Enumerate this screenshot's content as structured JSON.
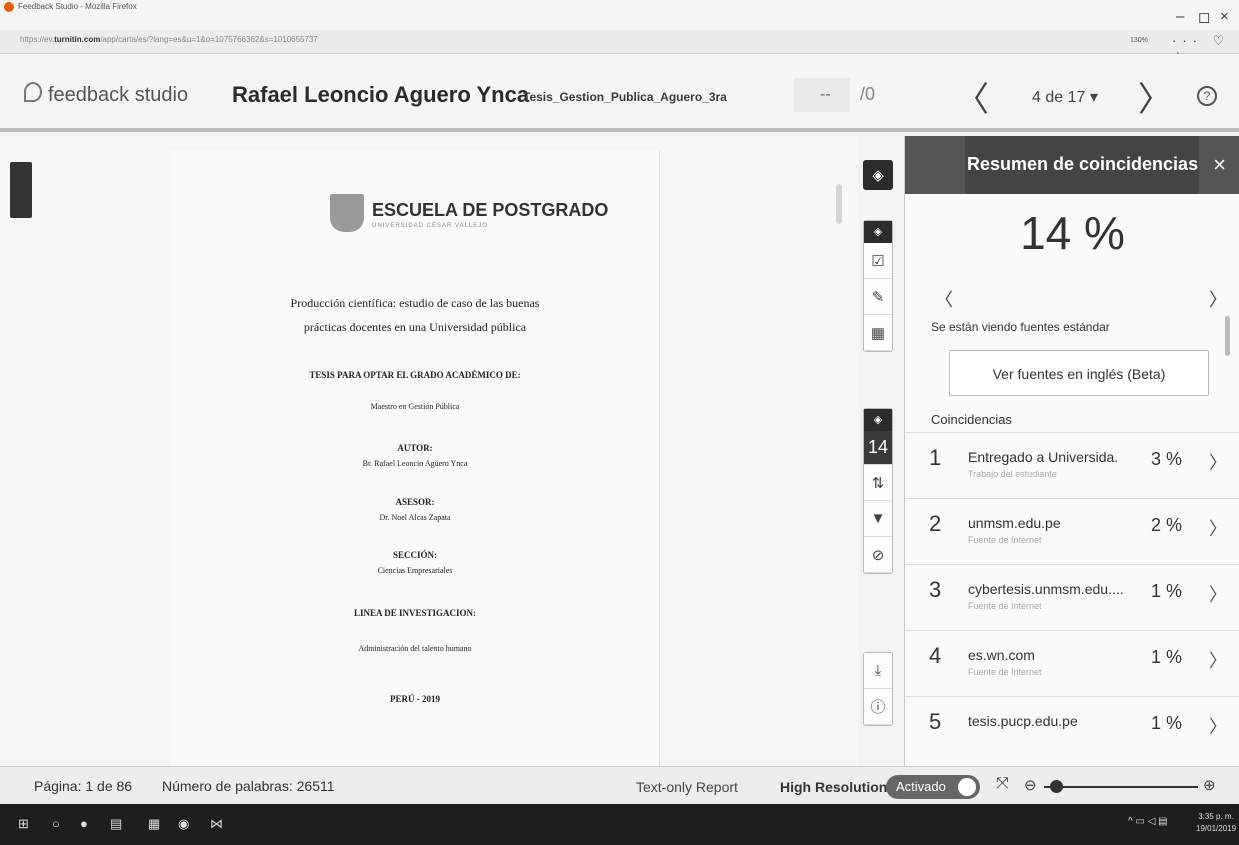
{
  "browser": {
    "window_title": "Feedback Studio - Mozilla Firefox",
    "url_prefix": "https://ev.",
    "url_domain": "turnitin.com",
    "url_rest": "/app/carta/es/?lang=es&u=1&o=1075766362&s=1010655737",
    "zoom": "130%",
    "controls": {
      "minimize": "–",
      "maximize": "◻",
      "close": "×"
    },
    "toolbar_icons": "··· ♡ ☆ ≡"
  },
  "header": {
    "logo_text": "feedback studio",
    "student_name": "Rafael Leoncio Aguero Ynca",
    "document_title": "Tesis_Gestion_Publica_Aguero_3ra",
    "grade_value": "--",
    "grade_max": "/0",
    "prev_label": "〈",
    "paper_counter": "4 de 17 ▾",
    "next_label": "〉",
    "help_label": "?"
  },
  "document": {
    "school_name": "ESCUELA DE POSTGRADO",
    "school_sub": "UNIVERSIDAD CÉSAR VALLEJO",
    "title_line1": "Producción científica: estudio de caso de las buenas",
    "title_line2": "prácticas docentes en una Universidad pública",
    "thesis_for": "TESIS PARA OPTAR EL GRADO ACADÉMICO DE:",
    "degree": "Maestro en Gestión Pública",
    "author_label": "AUTOR:",
    "author": "Br. Rafael Leoncio Agüero Ynca",
    "advisor_label": "ASESOR:",
    "advisor": "Dr. Noel Alcas Zapata",
    "section_label": "SECCIÓN:",
    "section": "Ciencias Empresariales",
    "research_label": "LINEA DE INVESTIGACION:",
    "research": "Administración del talento humano",
    "place_year": "PERÚ - 2019"
  },
  "toolbar": {
    "similarity_score": "14"
  },
  "panel": {
    "title": "Resumen de coincidencias",
    "close": "×",
    "overall_score": "14 %",
    "prev": "〈",
    "next": "〉",
    "sources_note": "Se están viendo fuentes estándar",
    "english_sources_button": "Ver fuentes en inglés (Beta)",
    "matches_heading": "Coincidencias",
    "matches": [
      {
        "num": "1",
        "source": "Entregado a Universida.",
        "type": "Trabajo del estudiante",
        "pct": "3 %"
      },
      {
        "num": "2",
        "source": "unmsm.edu.pe",
        "type": "Fuente de Internet",
        "pct": "2 %"
      },
      {
        "num": "3",
        "source": "cybertesis.unmsm.edu....",
        "type": "Fuente de Internet",
        "pct": "1 %"
      },
      {
        "num": "4",
        "source": "es.wn.com",
        "type": "Fuente de Internet",
        "pct": "1 %"
      },
      {
        "num": "5",
        "source": "tesis.pucp.edu.pe",
        "type": "",
        "pct": "1 %"
      }
    ]
  },
  "status": {
    "page_info": "Página: 1 de 86",
    "word_count": "Número de palabras: 26511",
    "text_only": "Text-only Report",
    "high_res_label": "High Resolution",
    "high_res_state": "Activado"
  },
  "taskbar": {
    "time": "3:35 p. m.",
    "date": "19/01/2019"
  },
  "colors": {
    "panel_header": "#444444",
    "toolbar_dark": "#2c2c2c",
    "background": "#f3f3f3"
  }
}
